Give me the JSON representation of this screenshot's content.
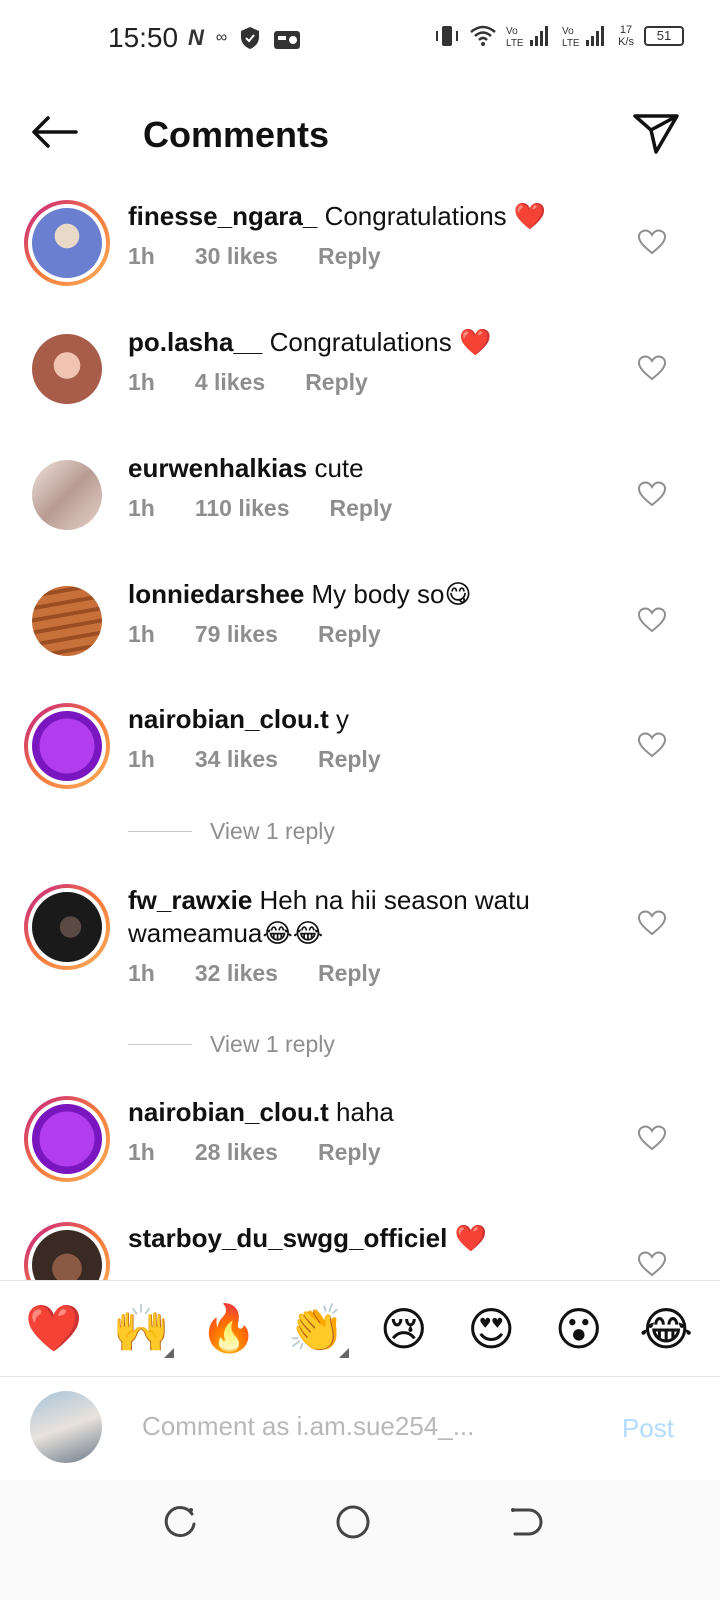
{
  "status_bar": {
    "time": "15:50",
    "network_speed_value": "17",
    "network_speed_unit": "K/s",
    "battery": "51",
    "icons": [
      "nfc-n-icon",
      "carrier-icon",
      "shield-icon",
      "radio-icon",
      "vibrate-icon",
      "wifi-icon",
      "volte-signal-icon",
      "volte-signal-icon"
    ]
  },
  "header": {
    "title": "Comments",
    "back_icon": "arrow-left-icon",
    "share_icon": "paper-plane-icon"
  },
  "comments": [
    {
      "username": "finesse_ngara_",
      "text": "Congratulations ❤️",
      "time": "1h",
      "likes": "30 likes",
      "reply": "Reply",
      "avatar_color": "#6a7fd0",
      "ring": true
    },
    {
      "username": "po.lasha__",
      "text": "Congratulations ❤️",
      "time": "1h",
      "likes": "4 likes",
      "reply": "Reply",
      "avatar_color": "#c98a6e",
      "ring": false
    },
    {
      "username": "eurwenhalkias",
      "text": "cute",
      "time": "1h",
      "likes": "110 likes",
      "reply": "Reply",
      "avatar_color": "#d8c6c2",
      "ring": false
    },
    {
      "username": "lonniedarshee",
      "text": "My body so😋",
      "time": "1h",
      "likes": "79 likes",
      "reply": "Reply",
      "avatar_color": "#b9622f",
      "ring": false
    },
    {
      "username": "nairobian_clou.t",
      "text": "y",
      "time": "1h",
      "likes": "34 likes",
      "reply": "Reply",
      "avatar_color": "#8e1fd6",
      "ring": true
    },
    {
      "username": "fw_rawxie",
      "text": "Heh na hii season watu wameamua😂😂",
      "time": "1h",
      "likes": "32 likes",
      "reply": "Reply",
      "avatar_color": "#2a2a2a",
      "ring": true
    },
    {
      "username": "nairobian_clou.t",
      "text": "haha",
      "time": "1h",
      "likes": "28 likes",
      "reply": "Reply",
      "avatar_color": "#8e1fd6",
      "ring": true
    },
    {
      "username": "starboy_du_swgg_officiel",
      "text": "❤️",
      "time": "",
      "likes": "",
      "reply": "",
      "avatar_color": "#7a4b3a",
      "ring": true
    }
  ],
  "view_replies": [
    "View 1 reply",
    "View 1 reply"
  ],
  "emoji_bar": [
    "❤️",
    "🙌",
    "🔥",
    "👏",
    "😢",
    "😍",
    "😮",
    "😂"
  ],
  "input": {
    "placeholder": "Comment as i.am.sue254_...",
    "value": "",
    "post_label": "Post"
  },
  "colors": {
    "accent_disabled": "#b3dbff",
    "meta_gray": "#8e8e8e",
    "story_ring_start": "#c21f8a",
    "story_ring_end": "#f9b35b"
  }
}
